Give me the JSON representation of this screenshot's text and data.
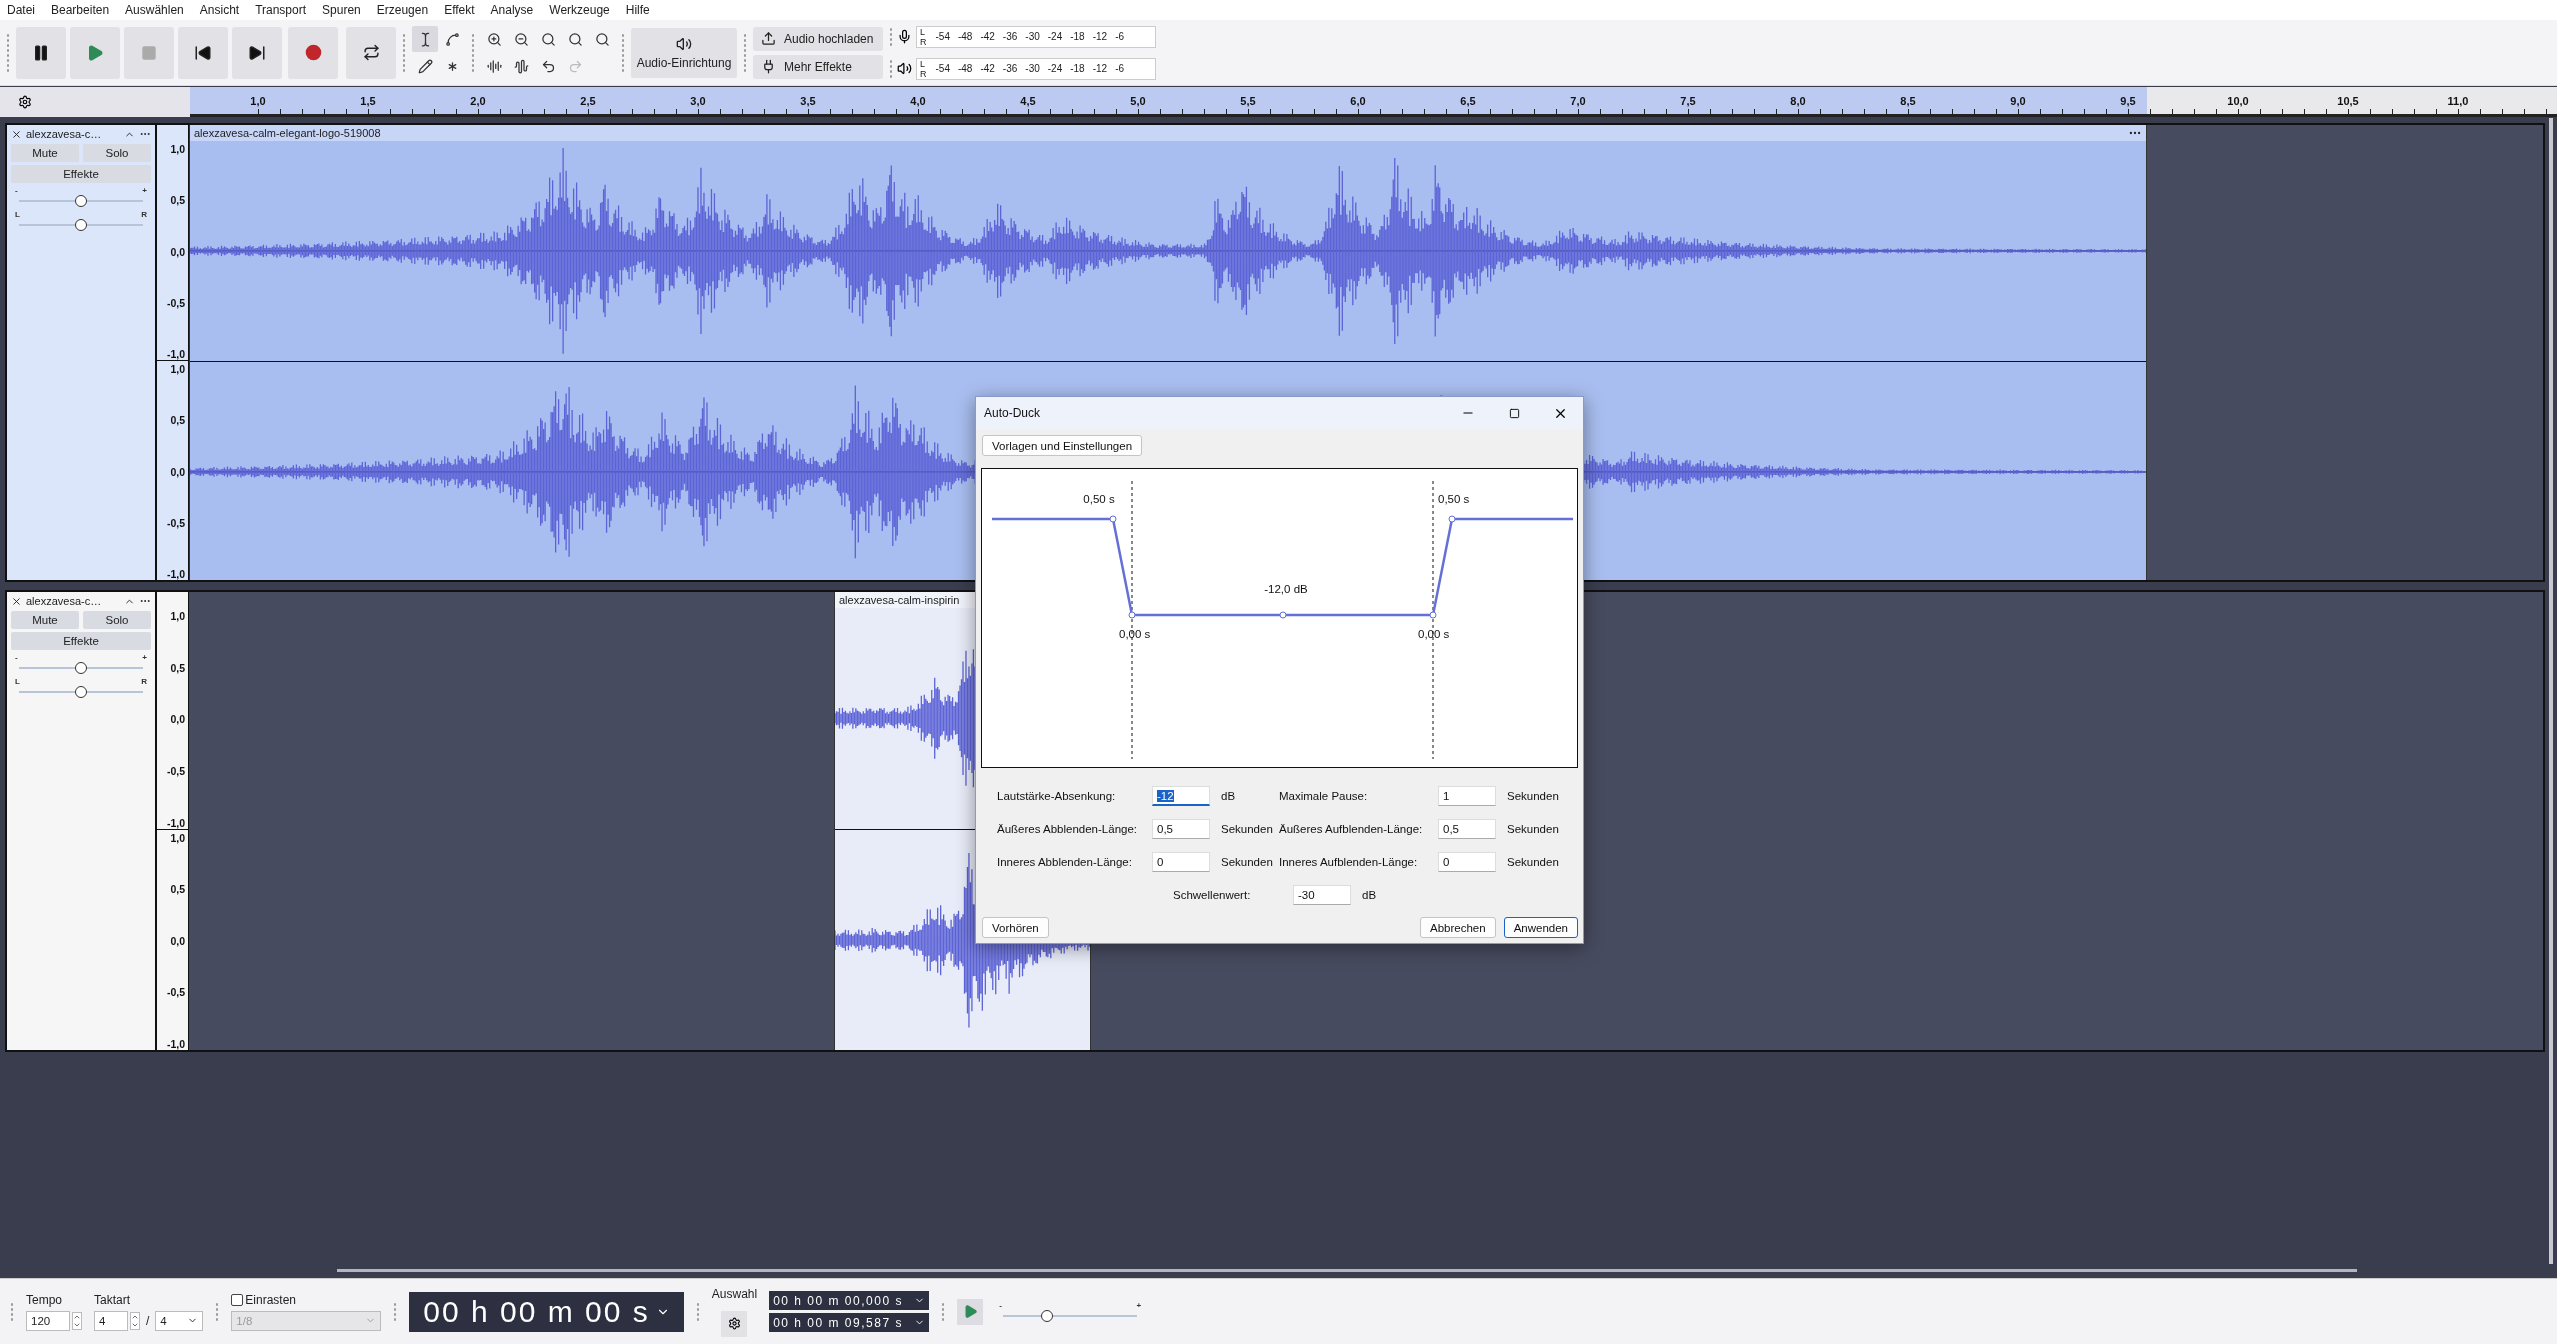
{
  "menu": [
    "Datei",
    "Bearbeiten",
    "Auswählen",
    "Ansicht",
    "Transport",
    "Spuren",
    "Erzeugen",
    "Effekt",
    "Analyse",
    "Werkzeuge",
    "Hilfe"
  ],
  "toolbar": {
    "tools": [
      {
        "kind": "select",
        "selected": true
      },
      {
        "kind": "envelope",
        "selected": false
      },
      {
        "kind": "draw",
        "selected": false
      },
      {
        "kind": "multi",
        "selected": false
      }
    ],
    "history": [
      {
        "kind": "undo",
        "disabled": false
      },
      {
        "kind": "redo",
        "disabled": true
      }
    ],
    "audio_setup": "Audio-Einrichtung",
    "share": "Audio hochladen",
    "effects": "Mehr Effekte",
    "meters": [
      {
        "kind": "record",
        "channels": [
          "L",
          "R"
        ],
        "scale": [
          "-54",
          "-48",
          "-42",
          "-36",
          "-30",
          "-24",
          "-18",
          "-12",
          "-6"
        ]
      },
      {
        "kind": "playback",
        "channels": [
          "L",
          "R"
        ],
        "scale": [
          "-54",
          "-48",
          "-42",
          "-36",
          "-30",
          "-24",
          "-18",
          "-12",
          "-6"
        ]
      }
    ]
  },
  "ruler": {
    "labels": [
      "1,0",
      "1,5",
      "2,0",
      "2,5",
      "3,0",
      "3,5",
      "4,0",
      "4,5",
      "5,0",
      "5,5",
      "6,0",
      "6,5",
      "7,0",
      "7,5",
      "8,0",
      "8,5",
      "9,0",
      "9,5",
      "10,0",
      "10,5",
      "11,0"
    ]
  },
  "tracks": [
    {
      "name": "alexzavesa-c…",
      "selected": true,
      "mute": "Mute",
      "solo": "Solo",
      "effects": "Effekte",
      "gain": {
        "min": "-",
        "max": "+",
        "level": 0.5
      },
      "pan": {
        "min": "L",
        "max": "R",
        "level": 0.5
      },
      "clip": {
        "name": "alexzavesa-calm-elegant-logo-519008"
      },
      "channels": [
        {
          "scale": [
            "1,0",
            "0,5",
            "0,0",
            "-0,5",
            "-1,0"
          ]
        },
        {
          "scale": [
            "1,0",
            "0,5",
            "0,0",
            "-0,5",
            "-1,0"
          ]
        }
      ]
    },
    {
      "name": "alexzavesa-c…",
      "selected": false,
      "mute": "Mute",
      "solo": "Solo",
      "effects": "Effekte",
      "gain": {
        "min": "-",
        "max": "+",
        "level": 0.5
      },
      "pan": {
        "min": "L",
        "max": "R",
        "level": 0.5
      },
      "clip": {
        "name": "alexzavesa-calm-inspirin"
      },
      "channels": [
        {
          "scale": [
            "1,0",
            "0,5",
            "0,0",
            "-0,5",
            "-1,0"
          ]
        },
        {
          "scale": [
            "1,0",
            "0,5",
            "0,0",
            "-0,5",
            "-1,0"
          ]
        }
      ]
    }
  ],
  "dialog": {
    "title": "Auto-Duck",
    "presets": "Vorlagen und Einstellungen",
    "graph_labels": [
      {
        "kind": "outer_out",
        "text": "0,50 s"
      },
      {
        "kind": "outer_in",
        "text": "0,50 s"
      },
      {
        "kind": "duck",
        "text": "-12,0 dB"
      },
      {
        "kind": "inner_out",
        "text": "0,00 s"
      },
      {
        "kind": "inner_in",
        "text": "0,00 s"
      }
    ],
    "fields": [
      {
        "label": "Lautstärke-Absenkung:",
        "value": "-12",
        "unit": "dB",
        "focused": true
      },
      {
        "label": "Maximale Pause:",
        "value": "1",
        "unit": "Sekunden",
        "focused": false
      },
      {
        "label": "Äußeres Abblenden-Länge:",
        "value": "0,5",
        "unit": "Sekunden",
        "focused": false
      },
      {
        "label": "Äußeres Aufblenden-Länge:",
        "value": "0,5",
        "unit": "Sekunden",
        "focused": false
      },
      {
        "label": "Inneres Abblenden-Länge:",
        "value": "0",
        "unit": "Sekunden",
        "focused": false
      },
      {
        "label": "Inneres Aufblenden-Länge:",
        "value": "0",
        "unit": "Sekunden",
        "focused": false
      }
    ],
    "threshold": {
      "label": "Schwellenwert:",
      "value": "-30",
      "unit": "dB"
    },
    "buttons": [
      {
        "label": "Vorhören",
        "default": false
      },
      {
        "label": "Abbrechen",
        "default": false
      },
      {
        "label": "Anwenden",
        "default": true
      }
    ]
  },
  "bottom": {
    "tempo": {
      "label": "Tempo",
      "value": "120"
    },
    "meter": {
      "label": "Taktart",
      "upper": "4",
      "separator": "/",
      "lower": "4"
    },
    "snap": {
      "label": "Einrasten",
      "checked": false,
      "value": "1/8"
    },
    "time": "00 h 00 m 00 s",
    "selection": {
      "label": "Auswahl",
      "start": "00 h 00 m 00,000 s",
      "end": "00 h 00 m 09,587 s"
    },
    "speed": {
      "min": "-",
      "max": "+",
      "level": 0.33
    }
  }
}
